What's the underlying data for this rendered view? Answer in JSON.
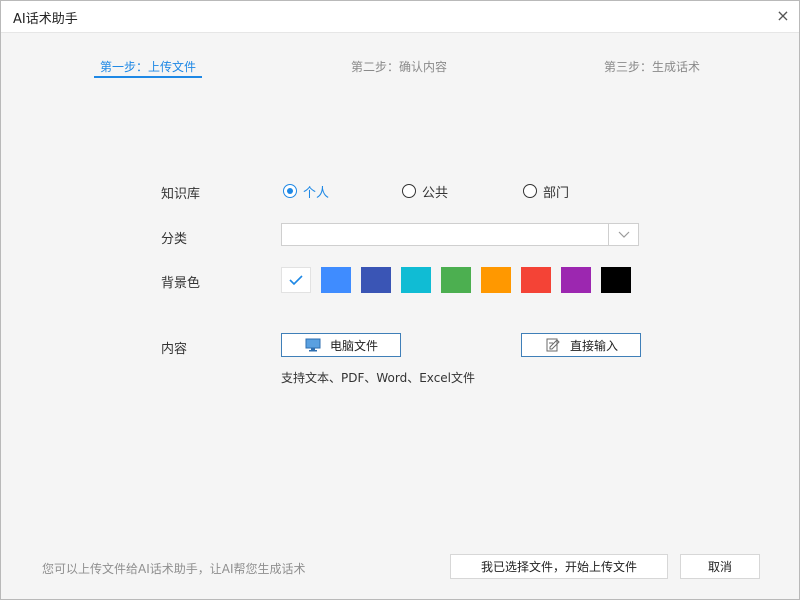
{
  "window": {
    "title": "AI话术助手",
    "close_symbol": "×"
  },
  "steps": [
    {
      "label": "第一步：上传文件",
      "active": true
    },
    {
      "label": "第二步：确认内容",
      "active": false
    },
    {
      "label": "第三步：生成话术",
      "active": false
    }
  ],
  "form": {
    "kb_label": "知识库",
    "kb_options": [
      {
        "label": "个人",
        "checked": true
      },
      {
        "label": "公共",
        "checked": false
      },
      {
        "label": "部门",
        "checked": false
      }
    ],
    "category_label": "分类",
    "category_value": "",
    "bg_label": "背景色",
    "bg_colors": [
      "#ffffff",
      "#3f8cff",
      "#3a55b5",
      "#10bcd4",
      "#4caf50",
      "#ff9800",
      "#f44336",
      "#9c27b0",
      "#000000"
    ],
    "selected_color_index": 0,
    "content_label": "内容",
    "pc_file_button": "电脑文件",
    "direct_input_button": "直接输入",
    "support_text": "支持文本、PDF、Word、Excel文件"
  },
  "footer": {
    "note": "您可以上传文件给AI话术助手，让AI帮您生成话术",
    "primary_button": "我已选择文件，开始上传文件",
    "cancel_button": "取消"
  },
  "colors": {
    "accent": "#1e88e5",
    "button_border": "#3f7fb8"
  },
  "icons": {
    "pc": "monitor-icon",
    "direct": "edit-document-icon",
    "dropdown": "chevron-down-icon",
    "check": "check-icon",
    "close": "close-icon"
  }
}
